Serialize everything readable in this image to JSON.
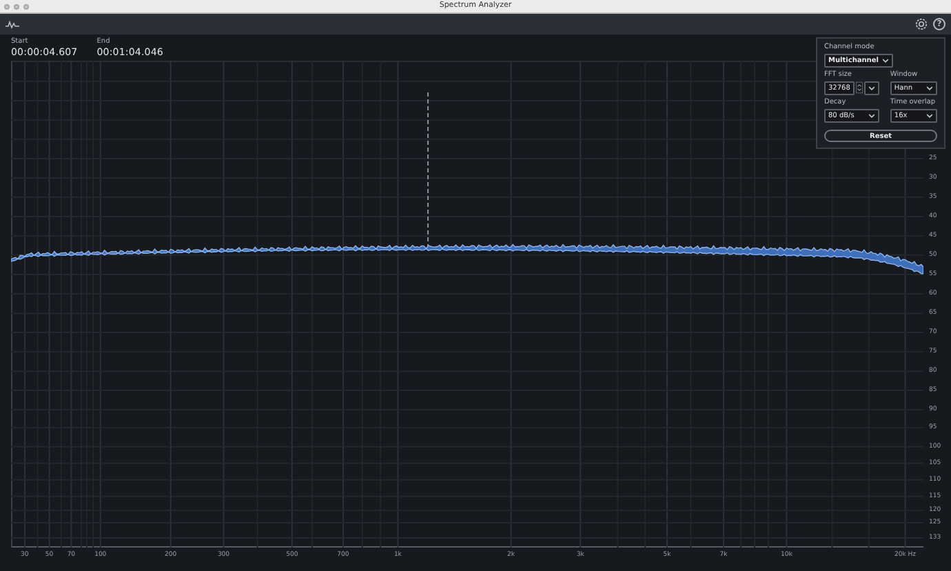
{
  "window": {
    "title": "Spectrum Analyzer"
  },
  "toolbar": {
    "help": "?"
  },
  "range": {
    "start_label": "Start",
    "start": "00:00:04.607",
    "end_label": "End",
    "end": "00:01:04.046"
  },
  "settings": {
    "fields": [
      {
        "label": "Channel mode",
        "value": "Multichannel",
        "kind": "select"
      },
      {
        "label": "FFT size",
        "value": "32768",
        "kind": "stepper"
      },
      {
        "label": "Window",
        "value": "Hann",
        "kind": "select"
      },
      {
        "label": "Decay",
        "value": "80 dB/s",
        "kind": "select"
      },
      {
        "label": "Time overlap",
        "value": "16x",
        "kind": "select"
      }
    ],
    "reset": "Reset"
  },
  "plot": {
    "x_ticks": [
      "30",
      "50",
      "70",
      "100",
      "200",
      "300",
      "500",
      "700",
      "1k",
      "2k",
      "3k",
      "5k",
      "7k",
      "10k",
      "20k Hz"
    ],
    "y_ticks": [
      "25",
      "30",
      "35",
      "40",
      "45",
      "50",
      "55",
      "60",
      "65",
      "70",
      "75",
      "80",
      "85",
      "90",
      "95",
      "100",
      "105",
      "110",
      "115",
      "120",
      "125",
      "133"
    ]
  }
}
